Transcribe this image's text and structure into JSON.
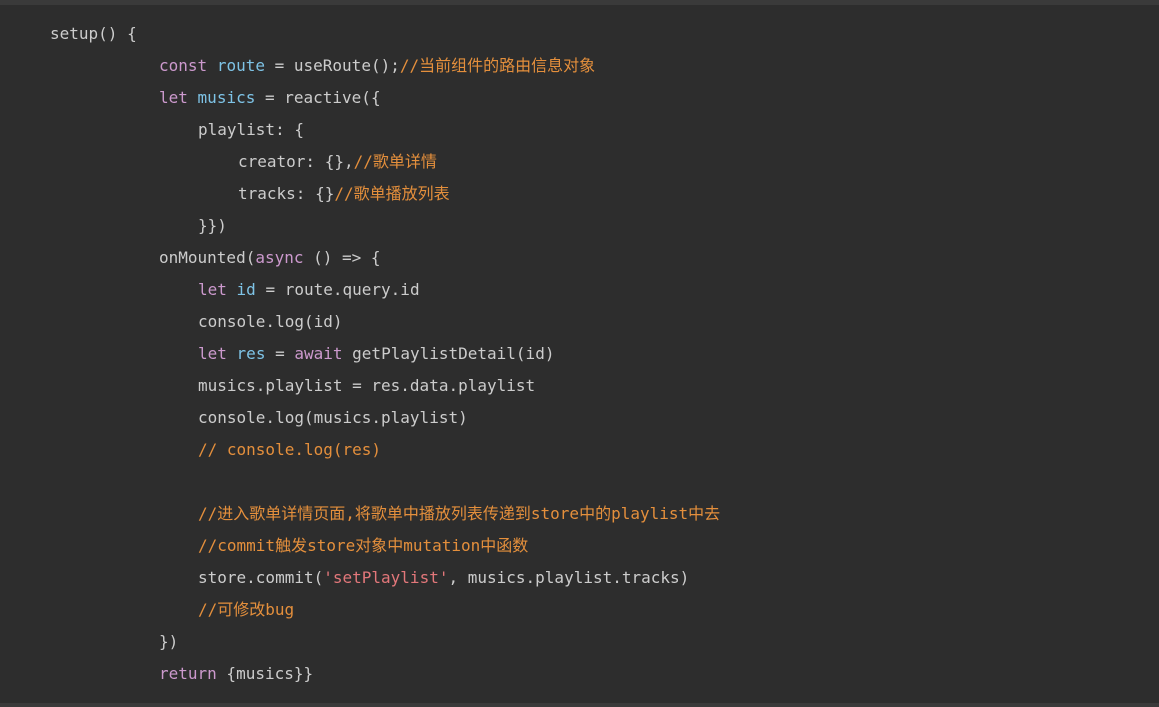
{
  "editor": {
    "background": "#2d2d2d",
    "lines": [
      {
        "tokens": [
          {
            "t": "setup() {",
            "c": "pl"
          }
        ]
      },
      {
        "tokens": [
          {
            "t": "const",
            "c": "kw"
          },
          {
            "t": " ",
            "c": "pl"
          },
          {
            "t": "route",
            "c": "var"
          },
          {
            "t": " = useRoute();",
            "c": "pl"
          },
          {
            "t": "//当前组件的路由信息对象",
            "c": "cmt"
          }
        ]
      },
      {
        "tokens": [
          {
            "t": "let",
            "c": "kw"
          },
          {
            "t": " ",
            "c": "pl"
          },
          {
            "t": "musics",
            "c": "var"
          },
          {
            "t": " = reactive({",
            "c": "pl"
          }
        ]
      },
      {
        "tokens": [
          {
            "t": "playlist: {",
            "c": "pl"
          }
        ]
      },
      {
        "tokens": [
          {
            "t": "creator: {},",
            "c": "pl"
          },
          {
            "t": "//歌单详情",
            "c": "cmt"
          }
        ]
      },
      {
        "tokens": [
          {
            "t": "tracks: {}",
            "c": "pl"
          },
          {
            "t": "//歌单播放列表",
            "c": "cmt"
          }
        ]
      },
      {
        "tokens": [
          {
            "t": "}})",
            "c": "pl"
          }
        ]
      },
      {
        "tokens": [
          {
            "t": "onMounted(",
            "c": "pl"
          },
          {
            "t": "async",
            "c": "kw"
          },
          {
            "t": " () => {",
            "c": "pl"
          }
        ]
      },
      {
        "tokens": [
          {
            "t": "let",
            "c": "kw"
          },
          {
            "t": " ",
            "c": "pl"
          },
          {
            "t": "id",
            "c": "var"
          },
          {
            "t": " = route.query.id",
            "c": "pl"
          }
        ]
      },
      {
        "tokens": [
          {
            "t": "console.log(id)",
            "c": "pl"
          }
        ]
      },
      {
        "tokens": [
          {
            "t": "let",
            "c": "kw"
          },
          {
            "t": " ",
            "c": "pl"
          },
          {
            "t": "res",
            "c": "var"
          },
          {
            "t": " = ",
            "c": "pl"
          },
          {
            "t": "await",
            "c": "kw"
          },
          {
            "t": " getPlaylistDetail(id)",
            "c": "pl"
          }
        ]
      },
      {
        "tokens": [
          {
            "t": "musics.playlist = res.data.playlist",
            "c": "pl"
          }
        ]
      },
      {
        "tokens": [
          {
            "t": "console.log(musics.playlist)",
            "c": "pl"
          }
        ]
      },
      {
        "tokens": [
          {
            "t": "// console.log(res)",
            "c": "cmt"
          }
        ]
      },
      {
        "tokens": [
          {
            "t": "",
            "c": "pl"
          }
        ]
      },
      {
        "tokens": [
          {
            "t": "//进入歌单详情页面,将歌单中播放列表传递到store中的playlist中去",
            "c": "cmt"
          }
        ]
      },
      {
        "tokens": [
          {
            "t": "//commit触发store对象中mutation中函数",
            "c": "cmt"
          }
        ]
      },
      {
        "tokens": [
          {
            "t": "store.commit(",
            "c": "pl"
          },
          {
            "t": "'setPlaylist'",
            "c": "str"
          },
          {
            "t": ", musics.playlist.tracks)",
            "c": "pl"
          }
        ]
      },
      {
        "tokens": [
          {
            "t": "//可修改bug",
            "c": "cmt"
          }
        ]
      },
      {
        "tokens": [
          {
            "t": "})",
            "c": "pl"
          }
        ]
      },
      {
        "tokens": [
          {
            "t": "return",
            "c": "kw"
          },
          {
            "t": " {musics}}",
            "c": "pl"
          }
        ]
      }
    ]
  },
  "colors": {
    "keyword": "#cc99cd",
    "variable": "#7ec3e6",
    "plain": "#cccccc",
    "comment": "#e48f3c",
    "string": "#e2777a"
  }
}
